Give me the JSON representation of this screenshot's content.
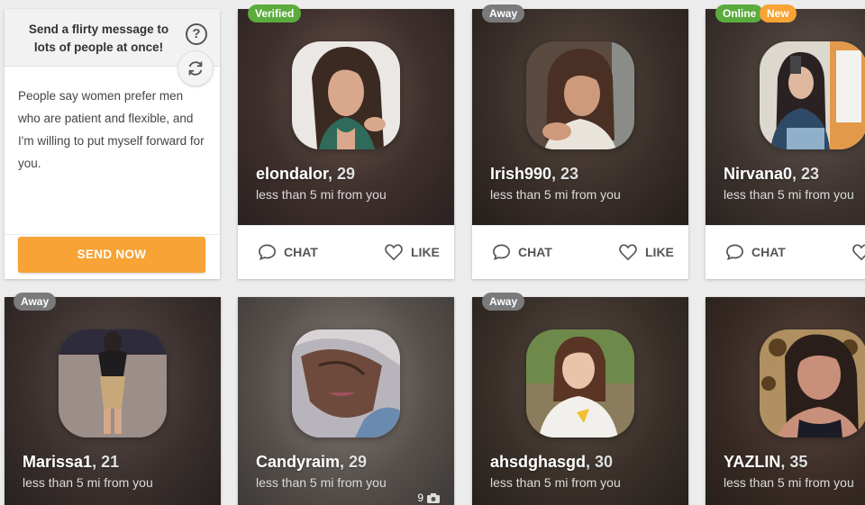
{
  "flirt_panel": {
    "title": "Send a flirty message to lots of people at once!",
    "help_glyph": "?",
    "help_icon": "help-icon",
    "refresh_icon": "refresh-icon",
    "message": "People say women prefer men who are patient and flexible, and I'm willing to put myself forward for you.",
    "send_label": "SEND NOW"
  },
  "actions": {
    "chat_label": "CHAT",
    "like_label": "LIKE"
  },
  "colors": {
    "accent_orange": "#f7a335",
    "badge_green": "#5bab3d",
    "badge_gray": "#7a7a7a"
  },
  "profiles": [
    {
      "name": "elondalor",
      "age": ", 29",
      "distance": "less than 5 mi from you",
      "badges": [
        "Verified"
      ]
    },
    {
      "name": "Irish990",
      "age": ", 23",
      "distance": "less than 5 mi from you",
      "badges": [
        "Away"
      ]
    },
    {
      "name": "Nirvana0",
      "age": ", 23",
      "distance": "less than 5 mi from you",
      "badges": [
        "Online",
        "New"
      ]
    },
    {
      "name": "Marissa1",
      "age": ", 21",
      "distance": "less than 5 mi from you",
      "badges": [
        "Away"
      ]
    },
    {
      "name": "Candyraim",
      "age": ", 29",
      "distance": "less than 5 mi from you",
      "badges": [],
      "photo_count": "9"
    },
    {
      "name": "ahsdghasgd",
      "age": ", 30",
      "distance": "less than 5 mi from you",
      "badges": [
        "Away"
      ]
    },
    {
      "name": "YAZLIN",
      "age": ", 35",
      "distance": "less than 5 mi from you",
      "badges": []
    }
  ]
}
